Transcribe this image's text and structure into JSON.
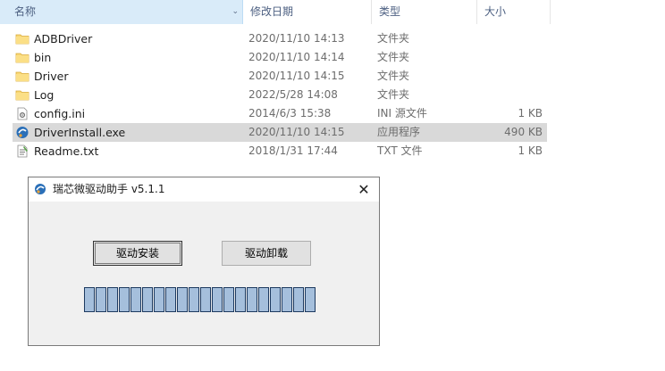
{
  "columns": {
    "name": "名称",
    "modified": "修改日期",
    "type": "类型",
    "size": "大小"
  },
  "files": [
    {
      "name": "ADBDriver",
      "modified": "2020/11/10 14:13",
      "type": "文件夹",
      "size": "",
      "icon": "folder-icon"
    },
    {
      "name": "bin",
      "modified": "2020/11/10 14:14",
      "type": "文件夹",
      "size": "",
      "icon": "folder-icon"
    },
    {
      "name": "Driver",
      "modified": "2020/11/10 14:15",
      "type": "文件夹",
      "size": "",
      "icon": "folder-icon"
    },
    {
      "name": "Log",
      "modified": "2022/5/28 14:08",
      "type": "文件夹",
      "size": "",
      "icon": "folder-icon"
    },
    {
      "name": "config.ini",
      "modified": "2014/6/3 15:38",
      "type": "INI 源文件",
      "size": "1 KB",
      "icon": "settings-file-icon"
    },
    {
      "name": "DriverInstall.exe",
      "modified": "2020/11/10 14:15",
      "type": "应用程序",
      "size": "490 KB",
      "icon": "app-icon",
      "selected": true
    },
    {
      "name": "Readme.txt",
      "modified": "2018/1/31 17:44",
      "type": "TXT 文件",
      "size": "1 KB",
      "icon": "text-file-icon"
    }
  ],
  "dialog": {
    "title": "瑞芯微驱动助手 v5.1.1",
    "close_glyph": "✕",
    "install_label": "驱动安装",
    "uninstall_label": "驱动卸载",
    "progress_segments": 20
  },
  "colors": {
    "header_selected": "#d9ebf9",
    "row_selected": "#d9d9d9",
    "progress_fill": "#a5bfdc",
    "progress_border": "#1d3a60",
    "folder": "#f8d775"
  }
}
